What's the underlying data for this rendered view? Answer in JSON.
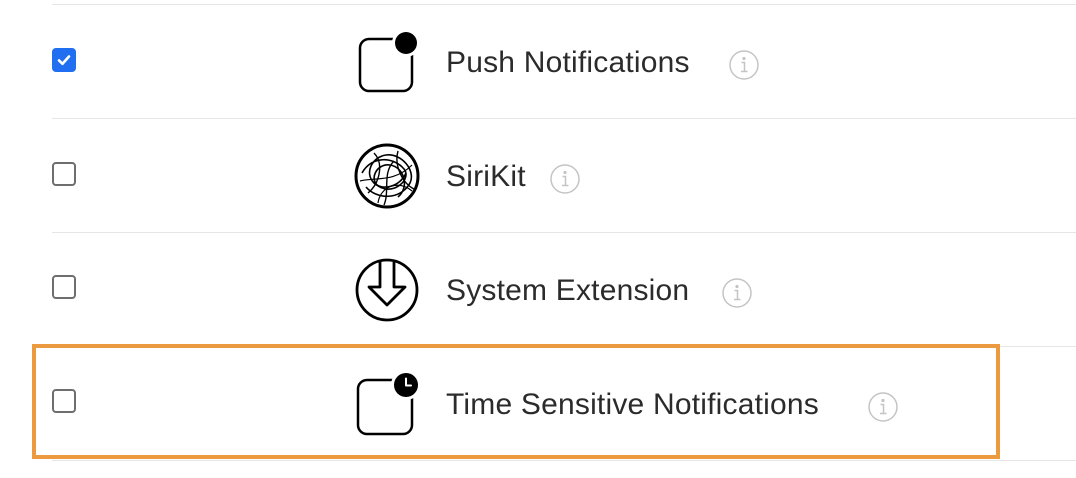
{
  "capabilities": {
    "items": [
      {
        "label": "Push Notifications",
        "checked": true,
        "icon": "push-notifications-icon"
      },
      {
        "label": "SiriKit",
        "checked": false,
        "icon": "sirikit-icon"
      },
      {
        "label": "System Extension",
        "checked": false,
        "icon": "system-extension-icon"
      },
      {
        "label": "Time Sensitive Notifications",
        "checked": false,
        "icon": "time-sensitive-notifications-icon"
      }
    ],
    "highlighted_item": "Time Sensitive Notifications"
  },
  "colors": {
    "checkbox_checked": "#1f6ff0",
    "highlight_border": "#ec9a3f",
    "divider": "#e6e6e6",
    "info_icon": "#c4c4c4",
    "text": "#2b2b2b"
  }
}
